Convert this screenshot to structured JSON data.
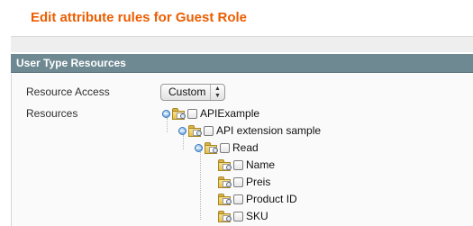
{
  "page": {
    "title": "Edit attribute rules for Guest Role"
  },
  "section": {
    "header": "User Type Resources"
  },
  "form": {
    "resource_access": {
      "label": "Resource Access",
      "value": "Custom"
    },
    "resources": {
      "label": "Resources"
    }
  },
  "tree": {
    "api_example": "APIExample",
    "api_extension_sample": "API extension sample",
    "read": "Read",
    "name": "Name",
    "preis": "Preis",
    "product_id": "Product ID",
    "sku": "SKU"
  }
}
